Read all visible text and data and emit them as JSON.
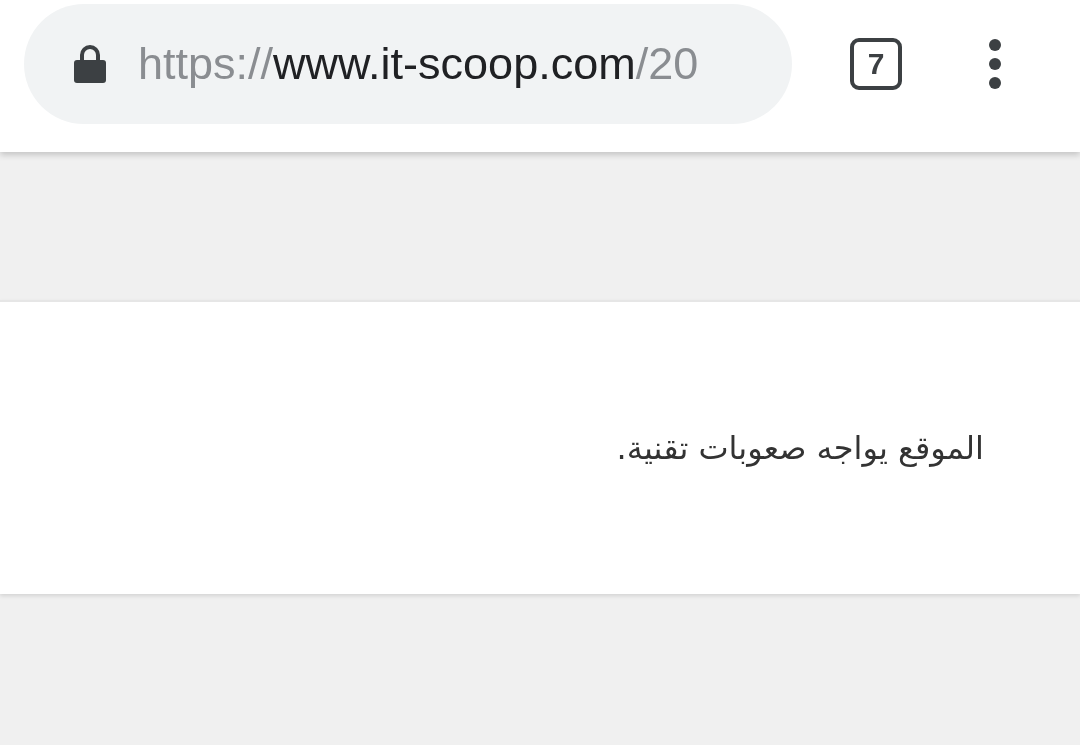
{
  "toolbar": {
    "url": {
      "scheme": "https://",
      "host": "www.it-scoop.com",
      "path": "/20"
    },
    "secure": true,
    "tab_count": "7"
  },
  "message": {
    "text": "الموقع يواجه صعوبات تقنية."
  }
}
